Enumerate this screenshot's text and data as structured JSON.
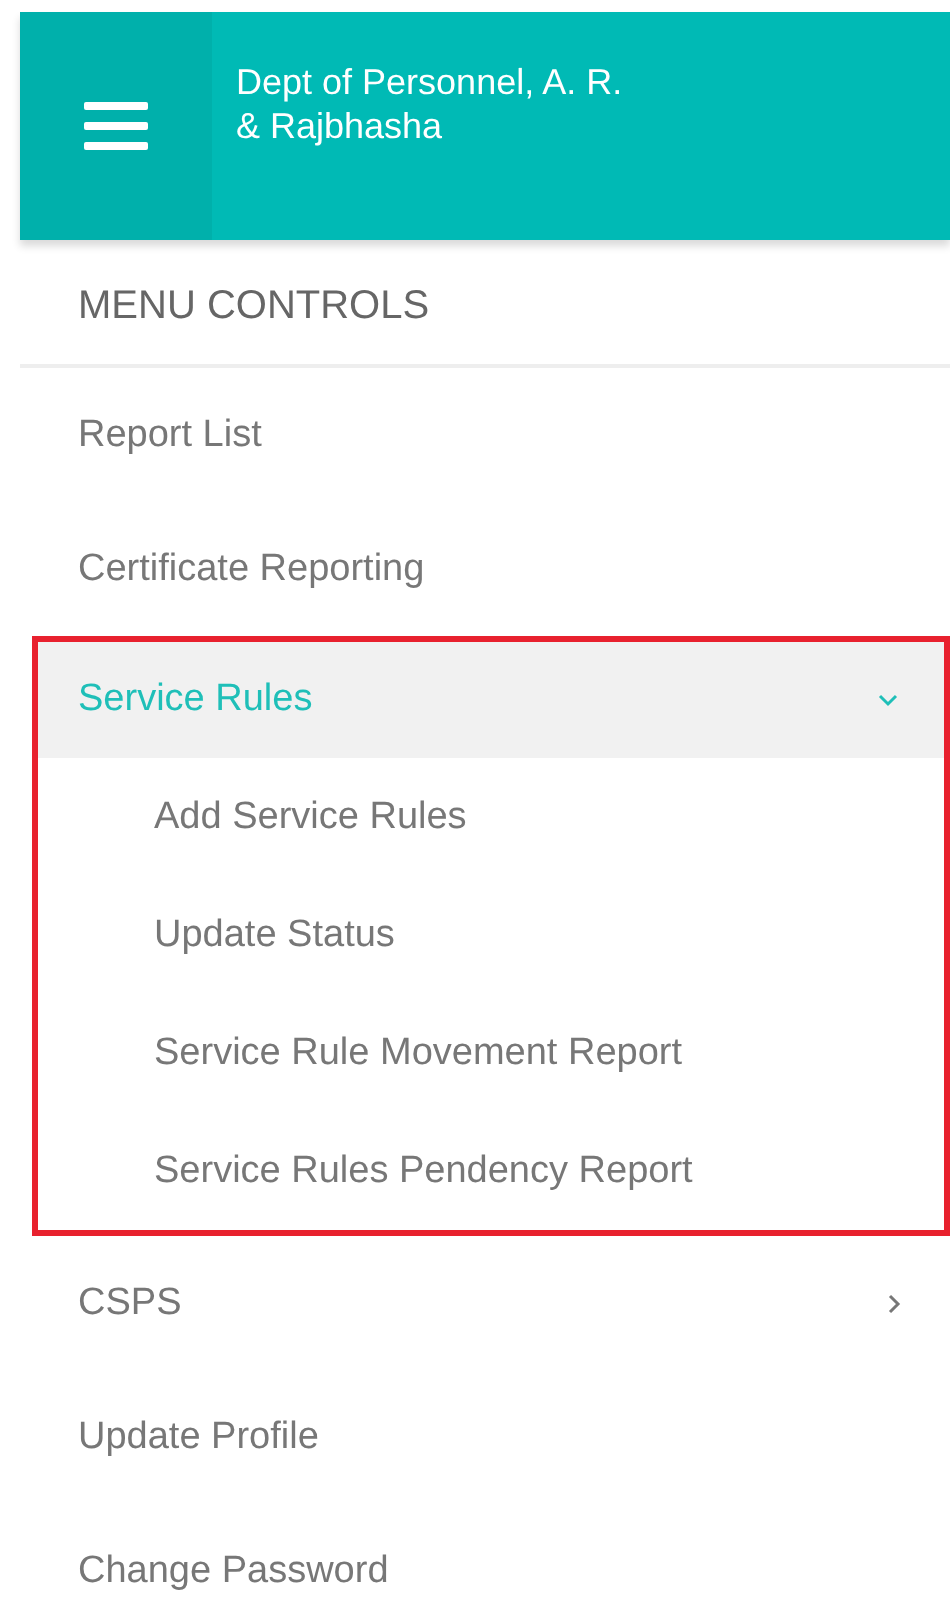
{
  "header": {
    "title": "Dept of Personnel, A. R.\n& Rajbhasha"
  },
  "menu": {
    "heading": "MENU CONTROLS",
    "items": [
      {
        "label": "Report List",
        "kind": "link"
      },
      {
        "label": "Certificate Reporting",
        "kind": "link"
      },
      {
        "label": "Service Rules",
        "kind": "group",
        "expanded": true,
        "selected": true,
        "highlighted": true,
        "children": [
          {
            "label": "Add Service Rules"
          },
          {
            "label": "Update Status"
          },
          {
            "label": "Service Rule Movement Report"
          },
          {
            "label": "Service Rules Pendency Report"
          }
        ]
      },
      {
        "label": "CSPS",
        "kind": "group",
        "expanded": false,
        "selected": false,
        "highlighted": false
      },
      {
        "label": "Update Profile",
        "kind": "link"
      },
      {
        "label": "Change Password",
        "kind": "link"
      }
    ]
  }
}
